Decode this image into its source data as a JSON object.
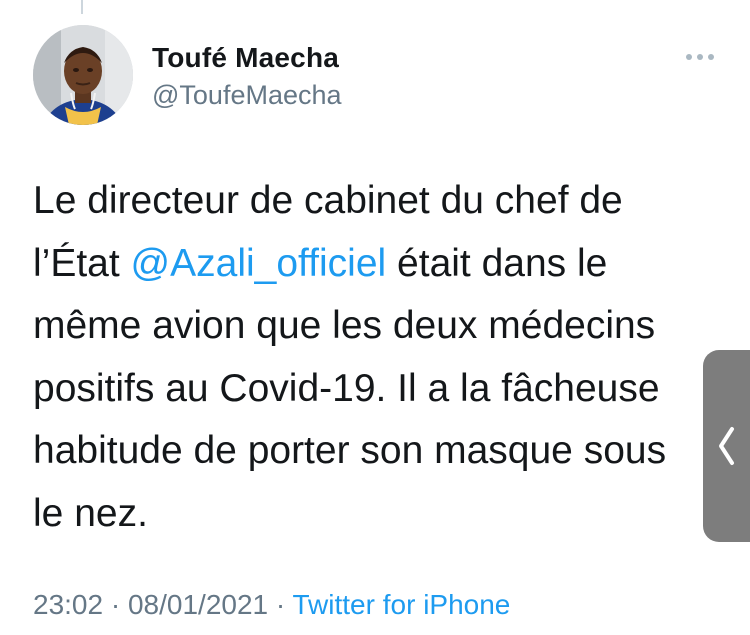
{
  "tweet": {
    "author": {
      "display_name": "Toufé Maecha",
      "handle": "@ToufeMaecha"
    },
    "text_lines": {
      "l1": "Le directeur de cabinet du chef de",
      "l2_pre": "l’État ",
      "l2_mention": "@Azali_officiel",
      "l2_post": " était dans le",
      "l3": "même avion que les deux médecins",
      "l4": "positifs au Covid-19. Il a la fâcheuse",
      "l5": "habitude de porter son masque sous",
      "l6": "le nez."
    },
    "time": "23:02",
    "date": "08/01/2021",
    "separator": "·",
    "source": "Twitter for iPhone"
  },
  "icons": {
    "more": "more-horizontal-icon",
    "side_panel": "chevron-left-icon"
  },
  "colors": {
    "link": "#1d9bf0",
    "secondary_text": "#657786",
    "side_handle": "#7d7d7d"
  }
}
